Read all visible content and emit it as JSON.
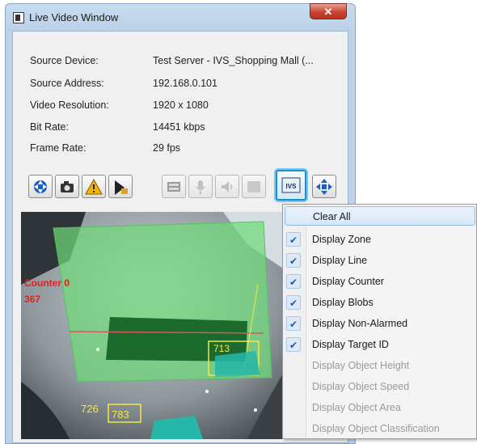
{
  "window": {
    "title": "Live Video Window",
    "close_label": "✕"
  },
  "info": [
    {
      "label": "Source Device:",
      "value": "Test Server - IVS_Shopping Mall (..."
    },
    {
      "label": "Source Address:",
      "value": "192.168.0.101"
    },
    {
      "label": "Video Resolution:",
      "value": "1920 x 1080"
    },
    {
      "label": "Bit Rate:",
      "value": "14451 kbps"
    },
    {
      "label": "Frame Rate:",
      "value": "29 fps"
    }
  ],
  "toolbar": {
    "ivs_label": "IVS",
    "buttons": [
      "ptz-arrows-icon",
      "camera-icon",
      "warning-icon",
      "export-icon",
      "record-icon",
      "microphone-icon",
      "speaker-icon",
      "grid-icon",
      "ivs-icon",
      "move-icon"
    ]
  },
  "video": {
    "counter_label": "Counter 0",
    "counter_value": "367",
    "target_id_1": "713",
    "target_id_2": "726",
    "target_id_3": "783"
  },
  "menu": {
    "items": [
      {
        "label": "Clear All",
        "checked": false,
        "enabled": true,
        "highlighted": true
      },
      {
        "label": "Display Zone",
        "checked": true,
        "enabled": true
      },
      {
        "label": "Display Line",
        "checked": true,
        "enabled": true
      },
      {
        "label": "Display Counter",
        "checked": true,
        "enabled": true
      },
      {
        "label": "Display Blobs",
        "checked": true,
        "enabled": true
      },
      {
        "label": "Display Non-Alarmed",
        "checked": true,
        "enabled": true
      },
      {
        "label": "Display Target ID",
        "checked": true,
        "enabled": true
      },
      {
        "label": "Display Object Height",
        "checked": false,
        "enabled": false
      },
      {
        "label": "Display Object Speed",
        "checked": false,
        "enabled": false
      },
      {
        "label": "Display Object Area",
        "checked": false,
        "enabled": false
      },
      {
        "label": "Display Object Classification",
        "checked": false,
        "enabled": false
      }
    ],
    "check_glyph": "✔"
  },
  "colors": {
    "zone": "#6fd97a",
    "highlight": "#1a8fd4",
    "alarm_text": "#e02020",
    "target_box": "#f2e84a"
  }
}
